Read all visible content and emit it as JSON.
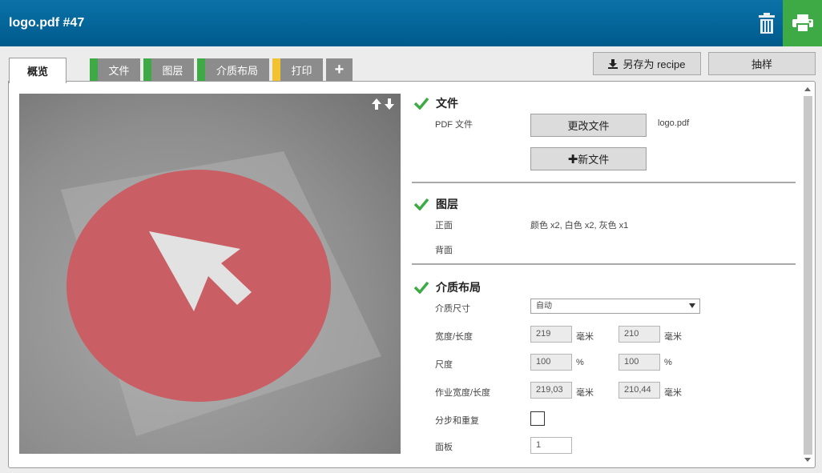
{
  "header": {
    "title": "logo.pdf #47"
  },
  "tabs": [
    {
      "label": "概览"
    },
    {
      "label": "文件",
      "status_color": "#3eaa46"
    },
    {
      "label": "图层",
      "status_color": "#3eaa46"
    },
    {
      "label": "介质布局",
      "status_color": "#3eaa46"
    },
    {
      "label": "打印",
      "status_color": "#f2c230"
    },
    {
      "label": "+"
    }
  ],
  "actions": {
    "save_recipe": "另存为 recipe",
    "sample": "抽样"
  },
  "sections": {
    "file": {
      "title": "文件",
      "pdf_label": "PDF 文件",
      "change_button": "更改文件",
      "file_name": "logo.pdf",
      "new_button": "新文件"
    },
    "layers": {
      "title": "图层",
      "front_label": "正面",
      "front_value": "颜色 x2, 白色 x2, 灰色 x1",
      "back_label": "背面"
    },
    "media": {
      "title": "介质布局",
      "size_label": "介质尺寸",
      "size_value": "自动",
      "width_length_label": "宽度/长度",
      "width": "219",
      "length": "210",
      "unit_mm": "毫米",
      "scale_label": "尺度",
      "scale_x": "100",
      "scale_y": "100",
      "unit_pct": "%",
      "job_size_label": "作业宽度/长度",
      "job_width": "219,03",
      "job_length": "210,44",
      "step_repeat_label": "分步和重复",
      "panel_label": "面板",
      "panel_value": "1"
    }
  },
  "colors": {
    "header": "#005a8c",
    "print": "#3eaa46",
    "check": "#3eaa46",
    "logo_circle": "#c95f64"
  },
  "icons": [
    "trash-icon",
    "printer-icon",
    "arrow-up-icon",
    "arrow-down-icon",
    "check-icon",
    "download-icon",
    "plus-icon"
  ]
}
